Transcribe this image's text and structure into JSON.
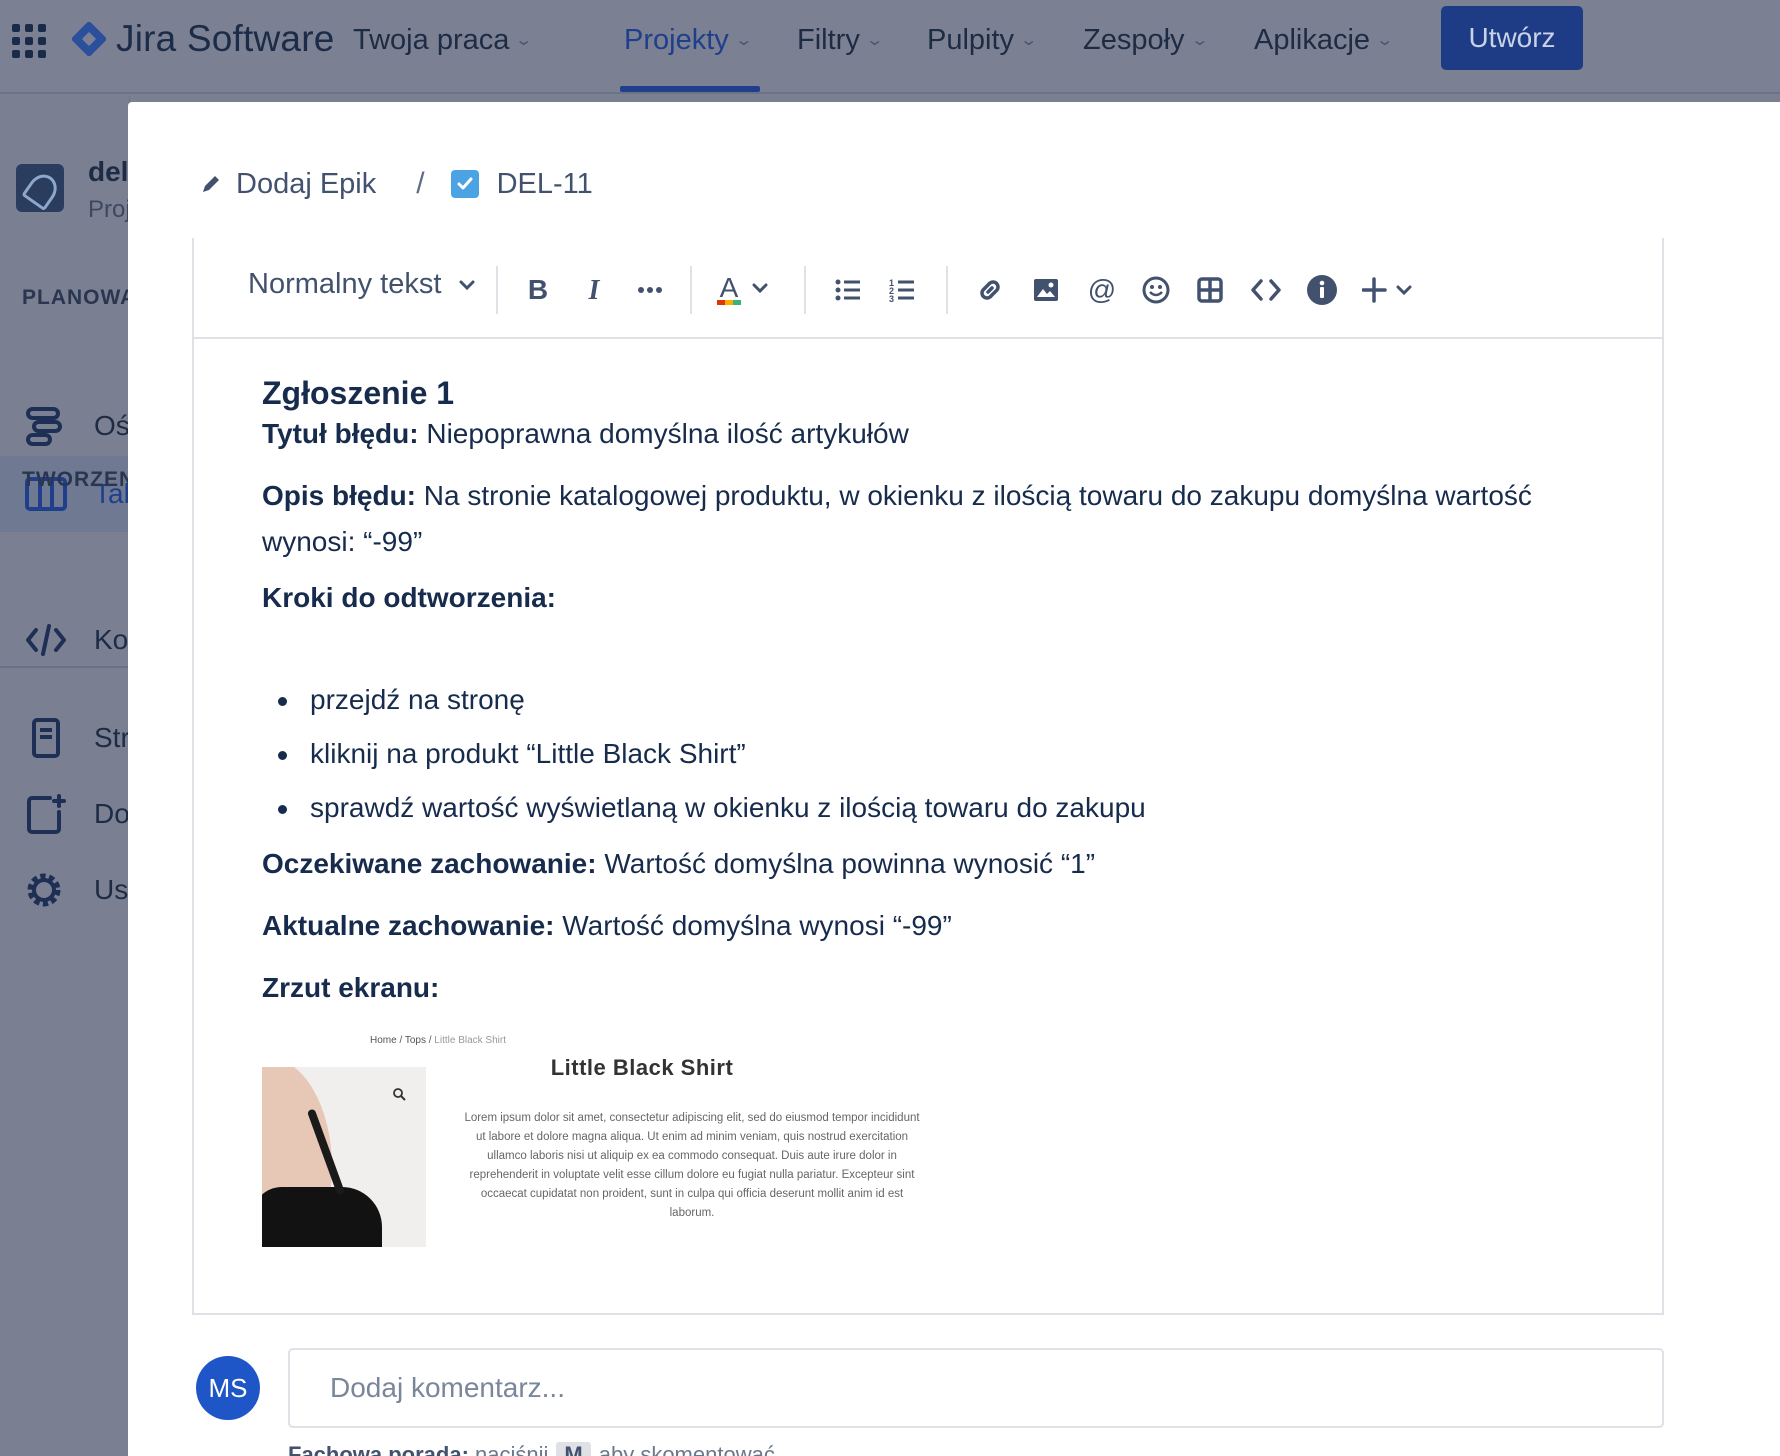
{
  "topnav": {
    "brand": "Jira Software",
    "items": [
      {
        "label": "Twoja praca"
      },
      {
        "label": "Projekty"
      },
      {
        "label": "Filtry"
      },
      {
        "label": "Pulpity"
      },
      {
        "label": "Zespoły"
      },
      {
        "label": "Aplikacje"
      }
    ],
    "active_item": "Projekty",
    "create_label": "Utwórz"
  },
  "sidebar": {
    "project_name": "del",
    "project_sub": "Proj",
    "sections": [
      {
        "label": "PLANOWA"
      },
      {
        "label": "TWORZEN"
      }
    ],
    "items": [
      {
        "label": "Oś",
        "icon": "timeline-icon"
      },
      {
        "label": "Tal",
        "icon": "board-icon",
        "selected": true
      },
      {
        "label": "Ko",
        "icon": "code-icon"
      },
      {
        "label": "Str",
        "icon": "pages-icon"
      },
      {
        "label": "Do",
        "icon": "add-item-icon"
      },
      {
        "label": "Ust",
        "icon": "gear-icon"
      }
    ]
  },
  "modal": {
    "breadcrumb": {
      "epic_label": "Dodaj Epik",
      "separator": "/",
      "issue_key": "DEL-11"
    },
    "toolbar": {
      "text_style": "Normalny tekst"
    },
    "content": {
      "heading": "Zgłoszenie 1",
      "title_label": "Tytuł błędu:",
      "title_value": " Niepoprawna domyślna ilość artykułów",
      "desc_label": "Opis błędu:",
      "desc_value": " Na stronie katalogowej produktu, w okienku z ilością towaru do zakupu domyślna wartość wynosi: “-99”",
      "steps_label": "Kroki do odtworzenia:",
      "steps": [
        "przejdź na stronę",
        "kliknij na produkt “Little Black Shirt”",
        "sprawdź wartość wyświetlaną w okienku z ilością towaru do zakupu"
      ],
      "expected_label": "Oczekiwane zachowanie:",
      "expected_value": " Wartość domyślna powinna wynosić “1”",
      "actual_label": "Aktualne zachowanie:",
      "actual_value": " Wartość domyślna wynosi “-99”",
      "screenshot_label": "Zrzut ekranu:",
      "screenshot": {
        "crumb_home": "Home / Tops / ",
        "crumb_current": "Little Black Shirt",
        "product_title": "Little Black Shirt",
        "lorem": "Lorem ipsum dolor sit amet, consectetur adipiscing elit, sed do eiusmod tempor incididunt ut labore et dolore magna aliqua. Ut enim ad minim veniam, quis nostrud exercitation ullamco laboris nisi ut aliquip ex ea commodo consequat. Duis aute irure dolor in reprehenderit in voluptate velit esse cillum dolore eu fugiat nulla pariatur. Excepteur sint occaecat cupidatat non proident, sunt in culpa qui officia deserunt mollit anim id est laborum."
      }
    },
    "comment": {
      "avatar_initials": "MS",
      "placeholder": "Dodaj komentarz...",
      "tip_label": "Fachowa porada:",
      "tip_pre": " naciśnij",
      "tip_key": "M",
      "tip_post": "aby skomentować"
    }
  },
  "colors": {
    "overlay": "#7a8092",
    "brand_blue": "#1f3e8c",
    "checkbox_blue": "#4ba3e3",
    "avatar_blue": "#1f56c7",
    "text": "#172b4d"
  }
}
